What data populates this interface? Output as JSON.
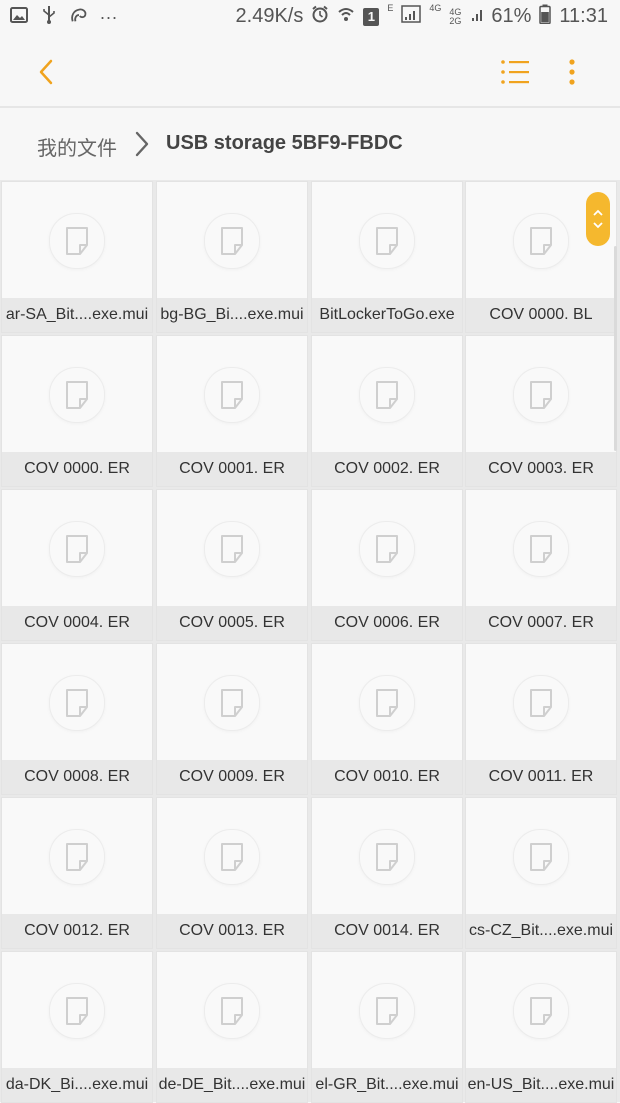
{
  "status_bar": {
    "overflow": "...",
    "speed": "2.49K/s",
    "sim_badge": "1",
    "net_e": "E",
    "net_4g": "4G",
    "net_4g2g": "4G 2G",
    "battery_pct": "61%",
    "time": "11:31",
    "icons": [
      "image-icon",
      "usb-icon",
      "uc-browser-icon",
      "alarm-icon",
      "wifi-icon",
      "sim-icon",
      "signal-icon",
      "battery-icon"
    ]
  },
  "action_bar": {
    "back_icon": "chevron-left-icon",
    "view_icon": "list-view-icon",
    "more_icon": "more-vertical-icon",
    "accent": "#f0a31e"
  },
  "breadcrumb": {
    "home": "我的文件",
    "current": "USB storage 5BF9-FBDC"
  },
  "files": [
    {
      "name": "ar-SA_Bit....exe.mui"
    },
    {
      "name": "bg-BG_Bi....exe.mui"
    },
    {
      "name": "BitLockerToGo.exe"
    },
    {
      "name": "COV 0000. BL"
    },
    {
      "name": "COV 0000. ER"
    },
    {
      "name": "COV 0001. ER"
    },
    {
      "name": "COV 0002. ER"
    },
    {
      "name": "COV 0003. ER"
    },
    {
      "name": "COV 0004. ER"
    },
    {
      "name": "COV 0005. ER"
    },
    {
      "name": "COV 0006. ER"
    },
    {
      "name": "COV 0007. ER"
    },
    {
      "name": "COV 0008. ER"
    },
    {
      "name": "COV 0009. ER"
    },
    {
      "name": "COV 0010. ER"
    },
    {
      "name": "COV 0011. ER"
    },
    {
      "name": "COV 0012. ER"
    },
    {
      "name": "COV 0013. ER"
    },
    {
      "name": "COV 0014. ER"
    },
    {
      "name": "cs-CZ_Bit....exe.mui"
    },
    {
      "name": "da-DK_Bi....exe.mui"
    },
    {
      "name": "de-DE_Bit....exe.mui"
    },
    {
      "name": "el-GR_Bit....exe.mui"
    },
    {
      "name": "en-US_Bit....exe.mui"
    }
  ]
}
